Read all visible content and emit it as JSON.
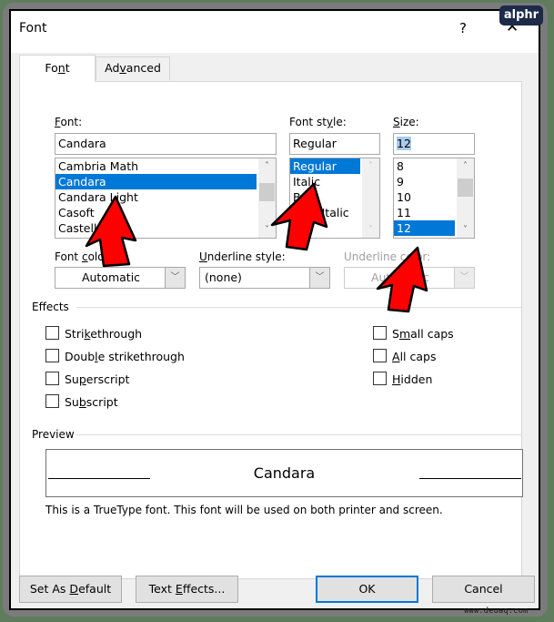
{
  "window": {
    "title": "Font",
    "help_label": "?",
    "close_label": "✕",
    "watermark": "alphr"
  },
  "tabs": [
    {
      "label": "Font",
      "active": true
    },
    {
      "label": "Advanced",
      "active": false
    }
  ],
  "font": {
    "label": "Font:",
    "value": "Candara",
    "options": [
      "Cambria Math",
      "Candara",
      "Candara Light",
      "Casoft",
      "Castellar"
    ],
    "selected": "Candara",
    "scroll_up_icon": "˄",
    "scroll_down_icon": "˅"
  },
  "font_style": {
    "label": "Font style:",
    "value": "Regular",
    "options": [
      "Regular",
      "Italic",
      "Bold",
      "Bold Italic"
    ],
    "selected": "Regular"
  },
  "size": {
    "label": "Size:",
    "value": "12",
    "options": [
      "8",
      "9",
      "10",
      "11",
      "12"
    ],
    "selected": "12"
  },
  "font_color": {
    "label": "Font color:",
    "value": "Automatic",
    "enabled": true
  },
  "underline_style": {
    "label": "Underline style:",
    "value": "(none)",
    "enabled": true
  },
  "underline_color": {
    "label": "Underline color:",
    "value": "Automatic",
    "enabled": false
  },
  "dropdown_icon": "﹀",
  "effects": {
    "label": "Effects",
    "left": [
      {
        "label": "Strikethrough",
        "checked": false
      },
      {
        "label": "Double strikethrough",
        "checked": false
      },
      {
        "label": "Superscript",
        "checked": false
      },
      {
        "label": "Subscript",
        "checked": false
      }
    ],
    "right": [
      {
        "label": "Small caps",
        "checked": false
      },
      {
        "label": "All caps",
        "checked": false
      },
      {
        "label": "Hidden",
        "checked": false
      }
    ]
  },
  "preview": {
    "label": "Preview",
    "sample_text": "Candara",
    "note": "This is a TrueType font. This font will be used on both printer and screen."
  },
  "buttons": {
    "set_default": "Set As Default",
    "text_effects": "Text Effects...",
    "ok": "OK",
    "cancel": "Cancel"
  },
  "annotations": {
    "arrow_color": "#ff0000",
    "arrow_count": 3
  },
  "credit": "www.deuaq.com"
}
